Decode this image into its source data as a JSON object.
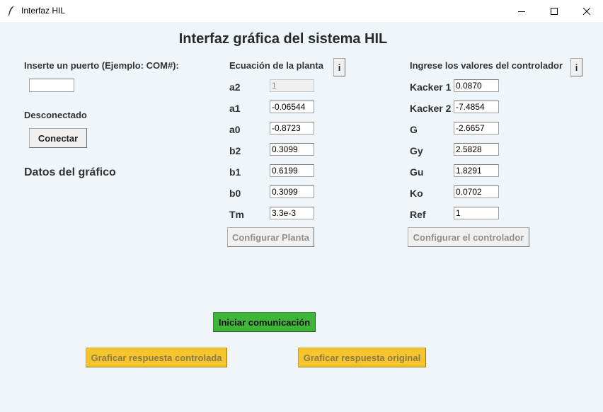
{
  "window": {
    "title": "Interfaz HIL",
    "minimize_symbol": "—",
    "maximize_symbol": "☐",
    "close_symbol": "✕"
  },
  "header": {
    "title": "Interfaz gráfica del sistema HIL"
  },
  "connection": {
    "port_label": "Inserte un puerto (Ejemplo: COM#):",
    "port_value": "",
    "status": "Desconectado",
    "connect_label": "Conectar",
    "chart_section_label": "Datos del gráfico"
  },
  "plant": {
    "title": "Ecuación de la planta",
    "info_label": "i",
    "rows": [
      {
        "label": "a2",
        "value": "1",
        "disabled": true
      },
      {
        "label": "a1",
        "value": "-0.06544"
      },
      {
        "label": "a0",
        "value": "-0.8723"
      },
      {
        "label": "b2",
        "value": "0.3099"
      },
      {
        "label": "b1",
        "value": "0.6199"
      },
      {
        "label": "b0",
        "value": "0.3099"
      },
      {
        "label": "Tm",
        "value": "3.3e-3"
      }
    ],
    "configure_label": "Configurar Planta"
  },
  "controller": {
    "title": "Ingrese los valores del controlador",
    "info_label": "i",
    "rows": [
      {
        "label": "Kacker 1",
        "value": "0.0870"
      },
      {
        "label": "Kacker 2",
        "value": "-7.4854"
      },
      {
        "label": "G",
        "value": "-2.6657"
      },
      {
        "label": "Gy",
        "value": "2.5828"
      },
      {
        "label": "Gu",
        "value": "1.8291"
      },
      {
        "label": "Ko",
        "value": "0.0702"
      },
      {
        "label": "Ref",
        "value": "1"
      }
    ],
    "configure_label": "Configurar el controlador"
  },
  "actions": {
    "start_label": "Iniciar comunicación",
    "plot_controlled_label": "Graficar respuesta controlada",
    "plot_original_label": "Graficar respuesta original"
  },
  "colors": {
    "background": "#f0f5fa",
    "start_button": "#3fb53a",
    "plot_buttons": "#f6c42c"
  }
}
